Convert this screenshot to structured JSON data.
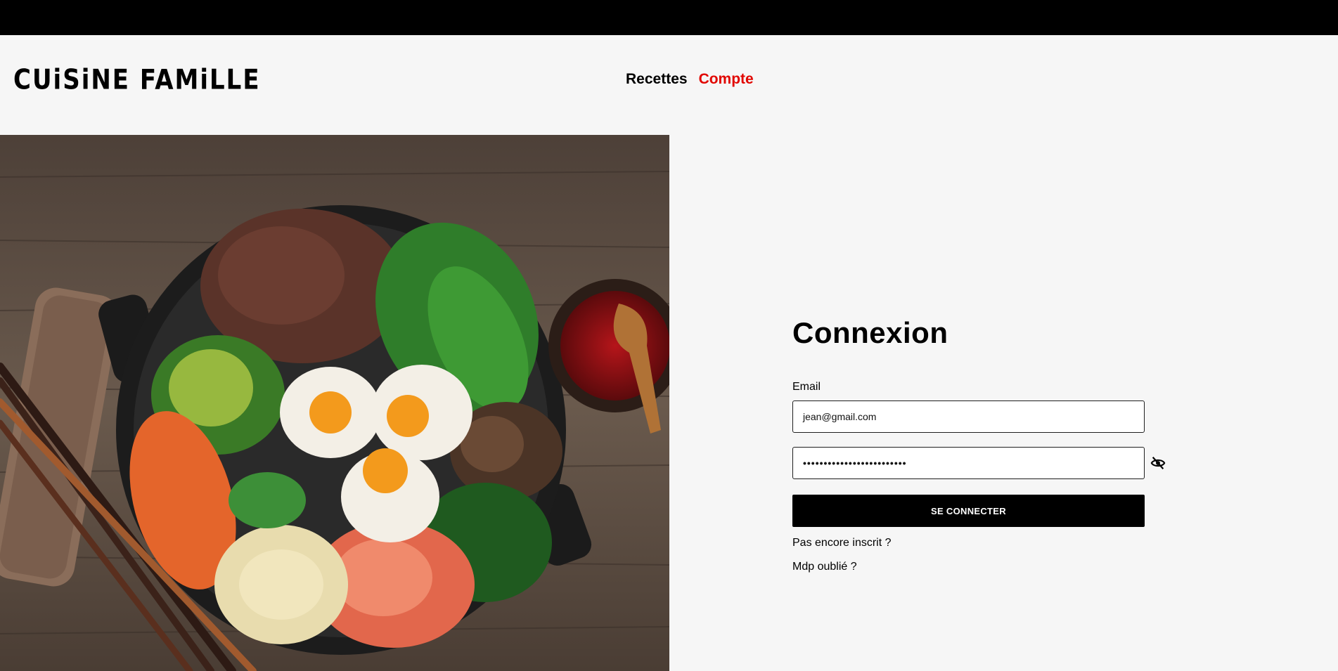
{
  "brand": {
    "logo": "CUiSiNE FAMiLLE"
  },
  "nav": {
    "items": [
      {
        "label": "Recettes",
        "active": false
      },
      {
        "label": "Compte",
        "active": true
      }
    ],
    "active_color": "#e10600"
  },
  "hero": {
    "image": "bibimbap-pan-on-wooden-table"
  },
  "login": {
    "title": "Connexion",
    "email_label": "Email",
    "email_value": "jean@gmail.com",
    "password_value": "•••••••••••••••••••••••••",
    "toggle_icon": "eye-off-icon",
    "submit_label": "SE CONNECTER",
    "register_link": "Pas encore inscrit ?",
    "forgot_link": "Mdp oublié ?"
  }
}
